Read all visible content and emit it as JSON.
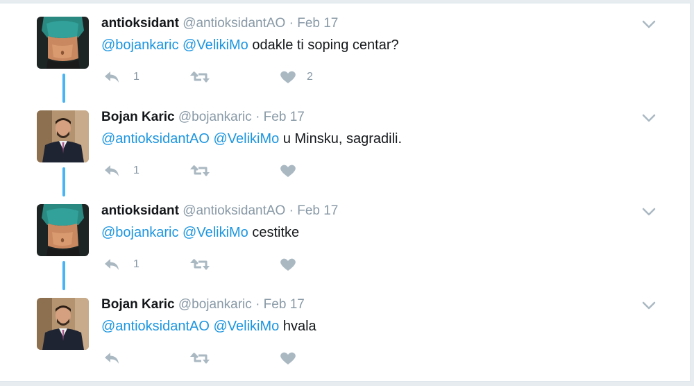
{
  "tweets": [
    {
      "fullname": "antioksidant",
      "handle": "@antioksidantAO",
      "dot": "·",
      "time": "Feb 17",
      "mentions": [
        "@bojankaric",
        "@VelikiMo"
      ],
      "text": "odakle ti soping centar?",
      "reply_count": "1",
      "like_count": "2",
      "avatar": "fitness-torso-avatar"
    },
    {
      "fullname": "Bojan Karic",
      "handle": "@bojankaric",
      "dot": "·",
      "time": "Feb 17",
      "mentions": [
        "@antioksidantAO",
        "@VelikiMo"
      ],
      "text": "u Minsku, sagradili.",
      "reply_count": "1",
      "like_count": "",
      "avatar": "man-in-suit-avatar"
    },
    {
      "fullname": "antioksidant",
      "handle": "@antioksidantAO",
      "dot": "·",
      "time": "Feb 17",
      "mentions": [
        "@bojankaric",
        "@VelikiMo"
      ],
      "text": "cestitke",
      "reply_count": "1",
      "like_count": "",
      "avatar": "fitness-torso-avatar"
    },
    {
      "fullname": "Bojan Karic",
      "handle": "@bojankaric",
      "dot": "·",
      "time": "Feb 17",
      "mentions": [
        "@antioksidantAO",
        "@VelikiMo"
      ],
      "text": "hvala",
      "reply_count": "",
      "like_count": "",
      "avatar": "man-in-suit-avatar"
    }
  ],
  "icons": {
    "reply": "reply-icon",
    "retweet": "retweet-icon",
    "like": "heart-icon",
    "more": "chevron-down-icon"
  },
  "colors": {
    "mention": "#1b95e0",
    "thread_line": "#4ab3f4",
    "muted": "#8899a6",
    "icon": "#aab8c2"
  }
}
